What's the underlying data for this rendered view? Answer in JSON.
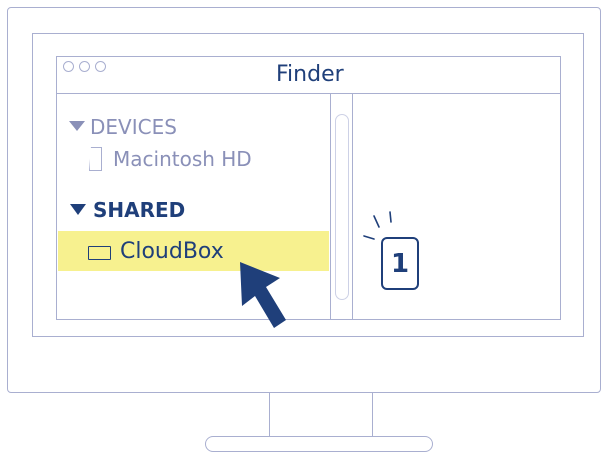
{
  "finder": {
    "title": "Finder"
  },
  "sidebar": {
    "devices_heading": "DEVICES",
    "devices_items": [
      {
        "label": "Macintosh HD",
        "icon": "drive-icon"
      }
    ],
    "shared_heading": "SHARED",
    "shared_items": [
      {
        "label": "CloudBox",
        "icon": "network-drive-icon",
        "highlighted": true
      }
    ]
  },
  "callout": {
    "step_number": "1"
  },
  "colors": {
    "primary": "#1f3f7a",
    "muted": "#8a90b8",
    "outline": "#a9afd0",
    "highlight": "#f7f18f"
  }
}
